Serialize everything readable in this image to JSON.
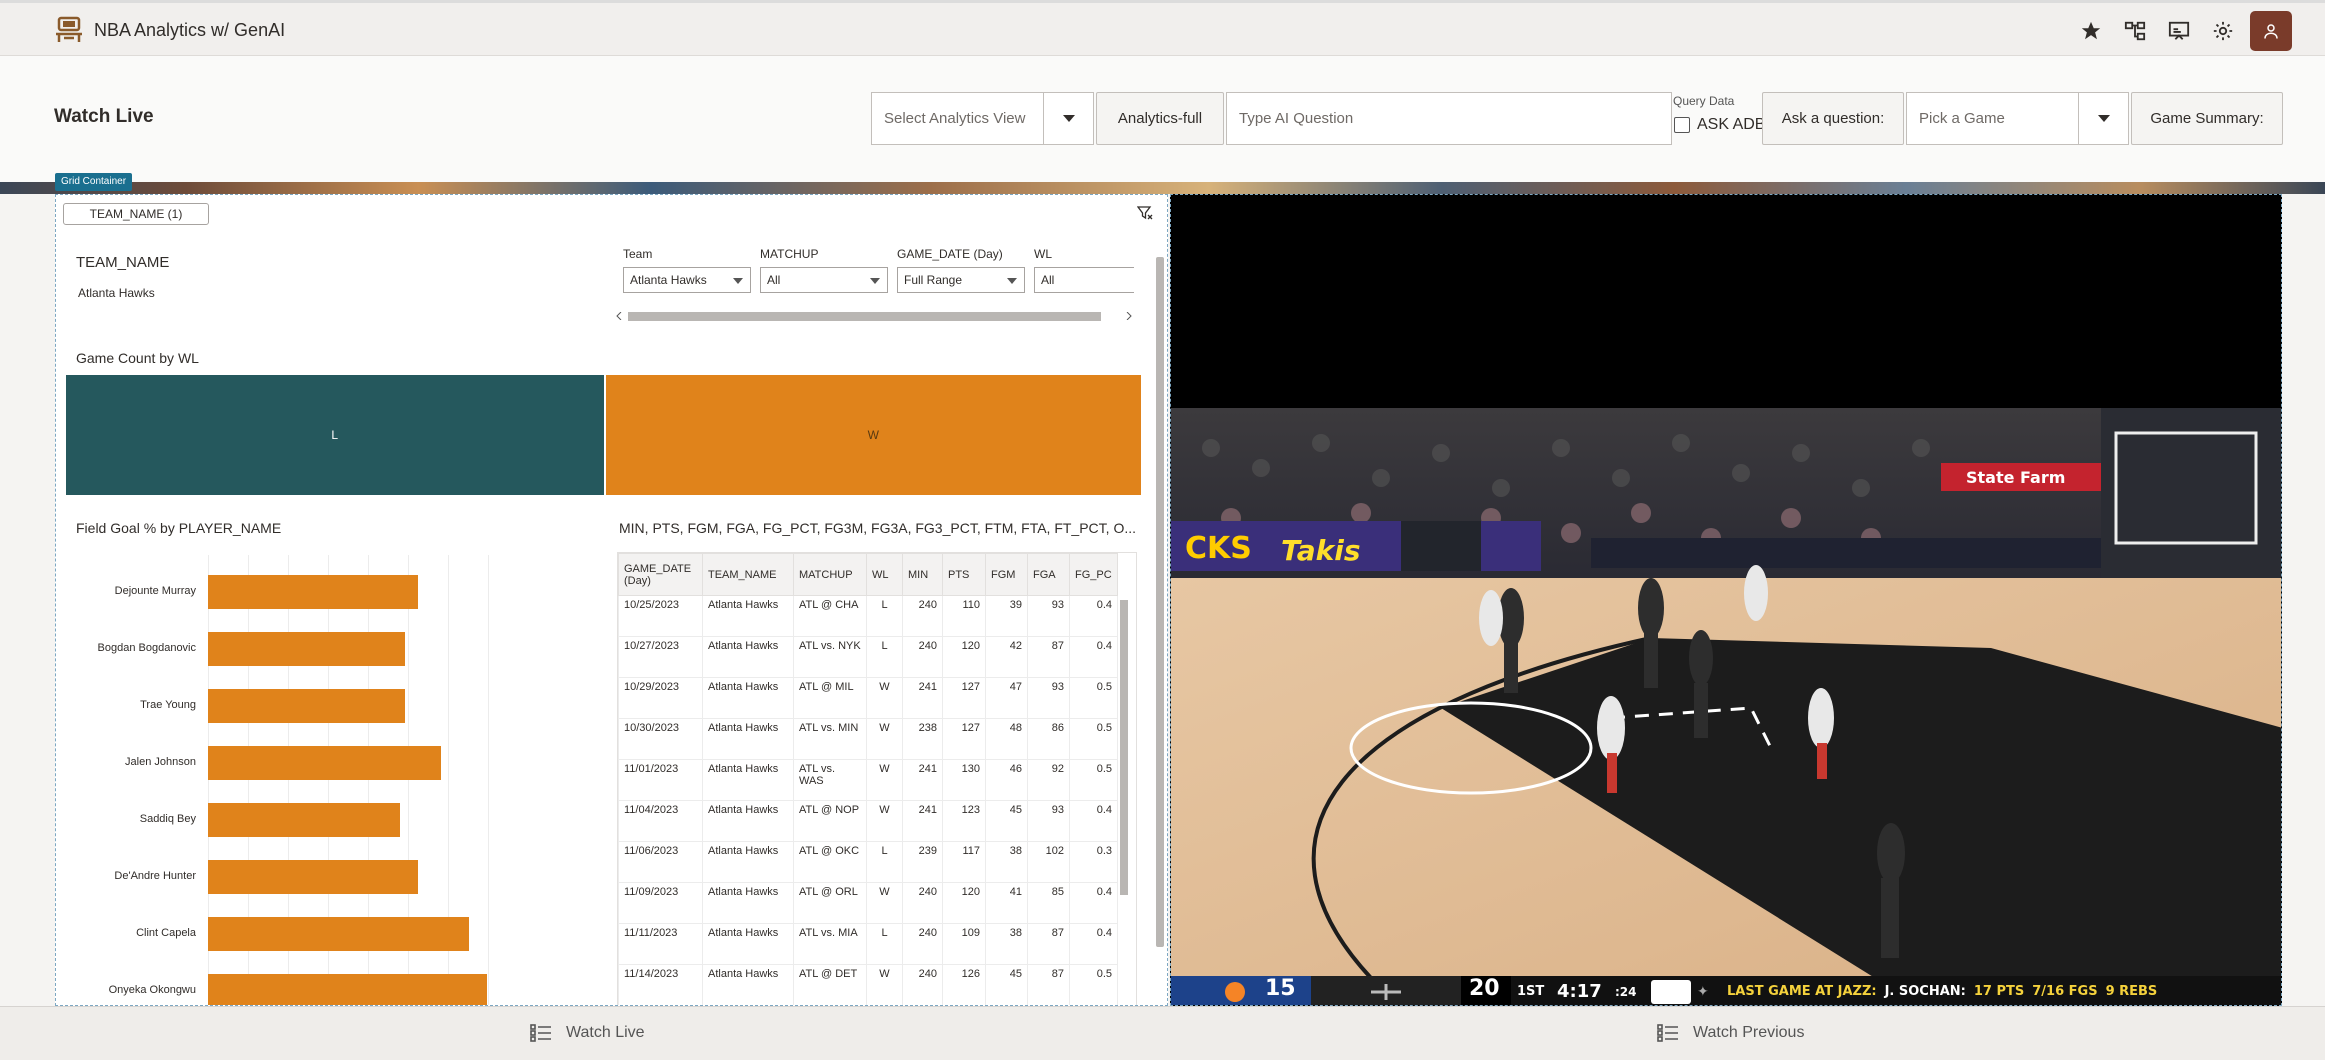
{
  "app": {
    "title": "NBA Analytics w/ GenAI"
  },
  "topbar": {
    "icons": [
      "star-icon",
      "hierarchy-icon",
      "presentation-icon",
      "gear-icon",
      "user-icon"
    ]
  },
  "page": {
    "title": "Watch Live"
  },
  "toolbar": {
    "analytics_view_placeholder": "Select Analytics View",
    "analytics_full_label": "Analytics-full",
    "ai_question_placeholder": "Type AI Question",
    "query_data_label": "Query Data",
    "ask_adb_label": "ASK ADB",
    "ask_question_label": "Ask a question:",
    "pick_game_placeholder": "Pick a Game",
    "game_summary_label": "Game Summary:"
  },
  "grid_container_tag": "Grid Container",
  "filters": {
    "chip": "TEAM_NAME (1)",
    "team_name_label": "TEAM_NAME",
    "team_name_value": "Atlanta Hawks",
    "controls": [
      {
        "label": "Team",
        "value": "Atlanta Hawks"
      },
      {
        "label": "MATCHUP",
        "value": "All"
      },
      {
        "label": "GAME_DATE (Day)",
        "value": "Full Range"
      },
      {
        "label": "WL",
        "value": "All"
      }
    ]
  },
  "game_count": {
    "title": "Game Count by WL",
    "segments": [
      {
        "label": "L",
        "share": 0.5,
        "color": "#25585d"
      },
      {
        "label": "W",
        "share": 0.5,
        "color": "#e0831b"
      }
    ]
  },
  "chart_data": {
    "type": "bar",
    "title": "Field Goal % by PLAYER_NAME",
    "orientation": "horizontal",
    "categories": [
      "Dejounte Murray",
      "Bogdan Bogdanovic",
      "Trae Young",
      "Jalen Johnson",
      "Saddiq Bey",
      "De'Andre Hunter",
      "Clint Capela",
      "Onyeka Okongwu"
    ],
    "values": [
      0.46,
      0.43,
      0.43,
      0.51,
      0.42,
      0.46,
      0.57,
      0.61
    ],
    "xlim": [
      0,
      0.7
    ],
    "color": "#e0831b",
    "grid": true
  },
  "stats_table": {
    "title": "MIN, PTS, FGM, FGA, FG_PCT, FG3M, FG3A, FG3_PCT, FTM, FTA, FT_PCT, O...",
    "columns": [
      "GAME_DATE (Day)",
      "TEAM_NAME",
      "MATCHUP",
      "WL",
      "MIN",
      "PTS",
      "FGM",
      "FGA",
      "FG_PC"
    ],
    "rows": [
      [
        "10/25/2023",
        "Atlanta Hawks",
        "ATL @ CHA",
        "L",
        "240",
        "110",
        "39",
        "93",
        "0.4"
      ],
      [
        "10/27/2023",
        "Atlanta Hawks",
        "ATL vs. NYK",
        "L",
        "240",
        "120",
        "42",
        "87",
        "0.4"
      ],
      [
        "10/29/2023",
        "Atlanta Hawks",
        "ATL @ MIL",
        "W",
        "241",
        "127",
        "47",
        "93",
        "0.5"
      ],
      [
        "10/30/2023",
        "Atlanta Hawks",
        "ATL vs. MIN",
        "W",
        "238",
        "127",
        "48",
        "86",
        "0.5"
      ],
      [
        "11/01/2023",
        "Atlanta Hawks",
        "ATL vs. WAS",
        "W",
        "241",
        "130",
        "46",
        "92",
        "0.5"
      ],
      [
        "11/04/2023",
        "Atlanta Hawks",
        "ATL @ NOP",
        "W",
        "241",
        "123",
        "45",
        "93",
        "0.4"
      ],
      [
        "11/06/2023",
        "Atlanta Hawks",
        "ATL @ OKC",
        "L",
        "239",
        "117",
        "38",
        "102",
        "0.3"
      ],
      [
        "11/09/2023",
        "Atlanta Hawks",
        "ATL @ ORL",
        "W",
        "240",
        "120",
        "41",
        "85",
        "0.4"
      ],
      [
        "11/11/2023",
        "Atlanta Hawks",
        "ATL vs. MIA",
        "L",
        "240",
        "109",
        "38",
        "87",
        "0.4"
      ],
      [
        "11/14/2023",
        "Atlanta Hawks",
        "ATL @ DET",
        "W",
        "240",
        "126",
        "45",
        "87",
        "0.5"
      ]
    ]
  },
  "video": {
    "arena_text_1": "CKS",
    "arena_text_2": "Takis",
    "arena_text_3": "State Farm",
    "scoreboard": {
      "home_score": "15",
      "away_score": "20",
      "period": "1ST",
      "clock": "4:17",
      "shot_clock": ":24",
      "ticker": "LAST GAME AT JAZZ:",
      "player": "J. SOCHAN:",
      "pts": "17 PTS",
      "fgs": "7/16 FGS",
      "rebs": "9 REBS"
    }
  },
  "bottom_nav": [
    {
      "label": "Watch Live",
      "icon": "list-icon"
    },
    {
      "label": "Watch Previous",
      "icon": "list-icon"
    }
  ]
}
